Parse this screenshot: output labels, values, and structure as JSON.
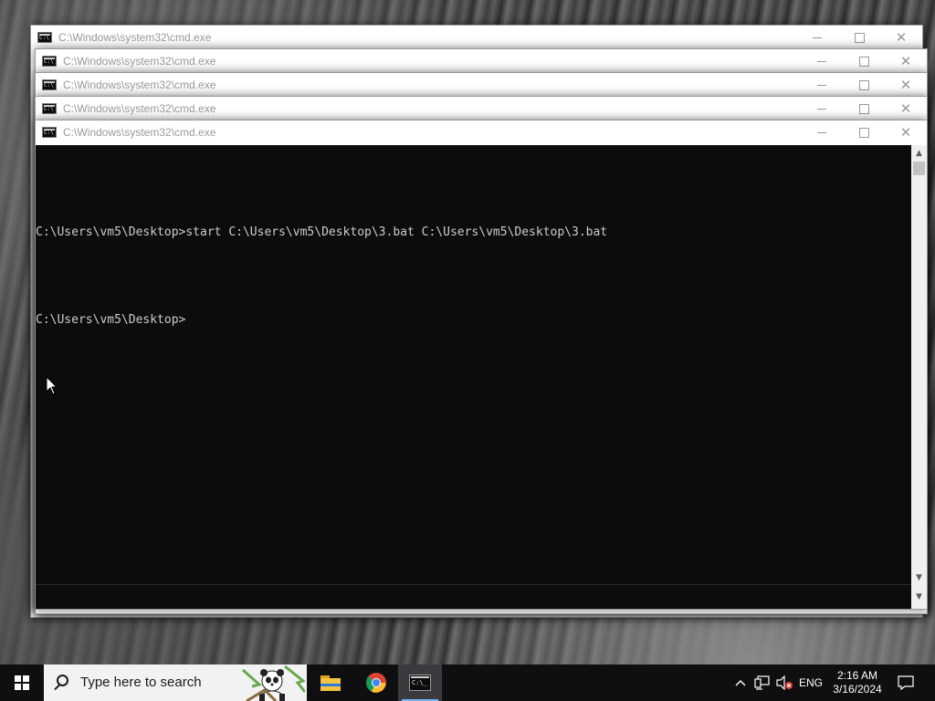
{
  "windows": [
    {
      "title": "C:\\Windows\\system32\\cmd.exe"
    },
    {
      "title": "C:\\Windows\\system32\\cmd.exe"
    },
    {
      "title": "C:\\Windows\\system32\\cmd.exe"
    },
    {
      "title": "C:\\Windows\\system32\\cmd.exe"
    },
    {
      "title": "C:\\Windows\\system32\\cmd.exe"
    }
  ],
  "console": {
    "line1": "C:\\Users\\vm5\\Desktop>start C:\\Users\\vm5\\Desktop\\3.bat C:\\Users\\vm5\\Desktop\\3.bat",
    "line2": "C:\\Users\\vm5\\Desktop>"
  },
  "taskbar": {
    "search_placeholder": "Type here to search",
    "language": "ENG",
    "time": "2:16 AM",
    "date": "3/16/2024",
    "pinned": [
      "file-explorer",
      "chrome",
      "command-prompt"
    ],
    "active_app": "command-prompt"
  },
  "icons": {
    "start": "windows-logo-icon",
    "search": "search-icon",
    "tray": [
      "chevron-up-icon",
      "network-icon",
      "volume-muted-icon",
      "notification-icon"
    ]
  }
}
